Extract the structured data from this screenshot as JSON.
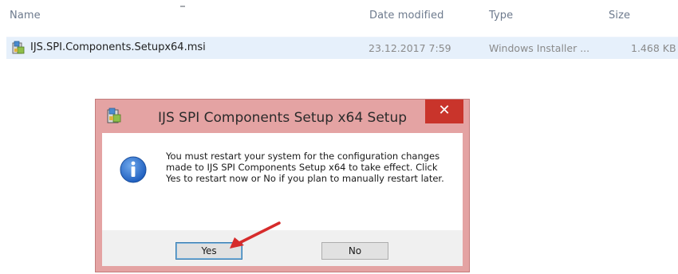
{
  "explorer": {
    "columns": {
      "name": "Name",
      "date_modified": "Date modified",
      "type": "Type",
      "size": "Size"
    },
    "file": {
      "name": "IJS.SPI.Components.Setupx64.msi",
      "date_modified": "23.12.2017 7:59",
      "type": "Windows Installer ...",
      "size": "1.468 KB",
      "icon": "msi-installer-icon"
    }
  },
  "dialog": {
    "title": "IJS SPI Components Setup x64 Setup",
    "close_label": "✕",
    "message": "You must restart your system for the configuration changes made to IJS SPI Components Setup x64 to take effect. Click Yes to restart now or No if you plan to manually restart later.",
    "icon": "info-icon",
    "buttons": {
      "yes": "Yes",
      "no": "No"
    },
    "colors": {
      "frame": "#e4a3a3",
      "close": "#c9342b",
      "info_blue": "#1f5fbf"
    }
  },
  "annotation": {
    "arrow_color": "#d62b2b"
  }
}
